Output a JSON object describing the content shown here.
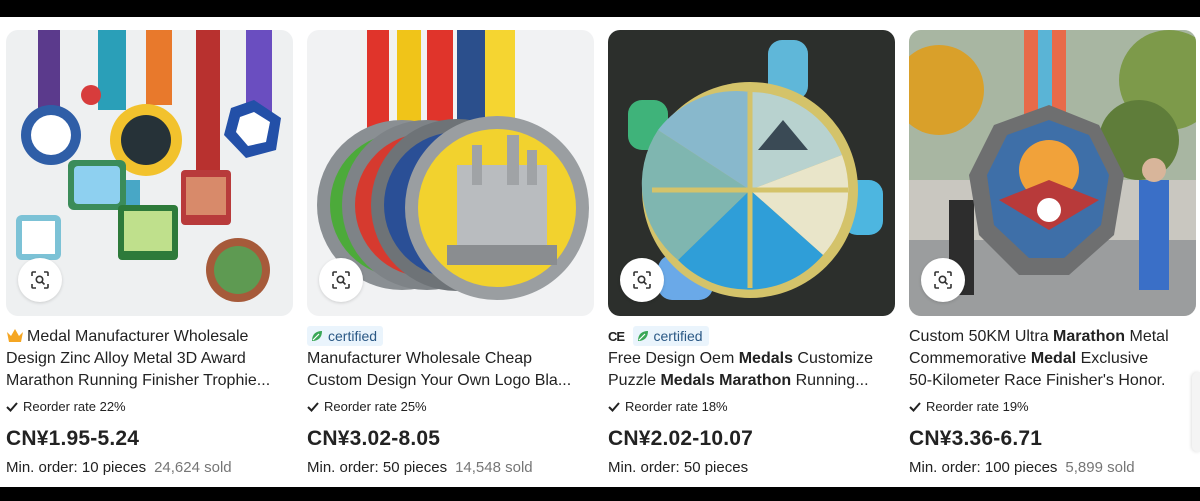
{
  "products": [
    {
      "badge_type": "crown",
      "badge_label": "",
      "title_line1": "Medal Manufacturer Wholesale",
      "title_line2": "Design Zinc Alloy Metal 3D Award",
      "title_line3": "Marathon Running Finisher Trophie...",
      "reorder": "Reorder rate 22%",
      "price": "CN¥1.95-5.24",
      "min_order": "Min. order: 10 pieces",
      "sold": "24,624 sold",
      "image_icon": "medal-collection-image",
      "lens_icon": "image-search-icon"
    },
    {
      "badge_type": "certified",
      "badge_label": "certified",
      "title_line1": "Manufacturer Wholesale Cheap",
      "title_line2": "Custom Design Your Own Logo Bla...",
      "title_line3": "",
      "reorder": "Reorder rate 25%",
      "price": "CN¥3.02-8.05",
      "min_order": "Min. order: 50 pieces",
      "sold": "14,548 sold",
      "image_icon": "qatar-running-medals-image",
      "lens_icon": "image-search-icon"
    },
    {
      "badge_type": "ce-certified",
      "badge_label": "certified",
      "ce_label": "CE",
      "title_line1": [
        "Free Design Oem ",
        "Medals",
        " Customize"
      ],
      "title_line2": [
        "Puzzle ",
        "Medals Marathon",
        " Running..."
      ],
      "title_line3": "",
      "reorder": "Reorder rate 18%",
      "price": "CN¥2.02-10.07",
      "min_order": "Min. order: 50 pieces",
      "sold": "",
      "image_icon": "puzzle-medal-image",
      "lens_icon": "image-search-icon"
    },
    {
      "badge_type": "none",
      "badge_label": "",
      "title_line1": [
        "Custom 50KM Ultra ",
        "Marathon",
        " Metal"
      ],
      "title_line2": [
        "Commemorative ",
        "Medal",
        " Exclusive"
      ],
      "title_line3": "50-Kilometer Race Finisher's Honor.",
      "reorder": "Reorder rate 19%",
      "price": "CN¥3.36-6.71",
      "min_order": "Min. order: 100 pieces",
      "sold": "5,899 sold",
      "image_icon": "eagle-medal-image",
      "lens_icon": "image-search-icon"
    }
  ],
  "colors": {
    "certified_bg": "#eaf4fc",
    "certified_text": "#2a5885",
    "leaf_green": "#3aa757",
    "crown_gold": "#f5a623",
    "sold_gray": "#767676"
  }
}
